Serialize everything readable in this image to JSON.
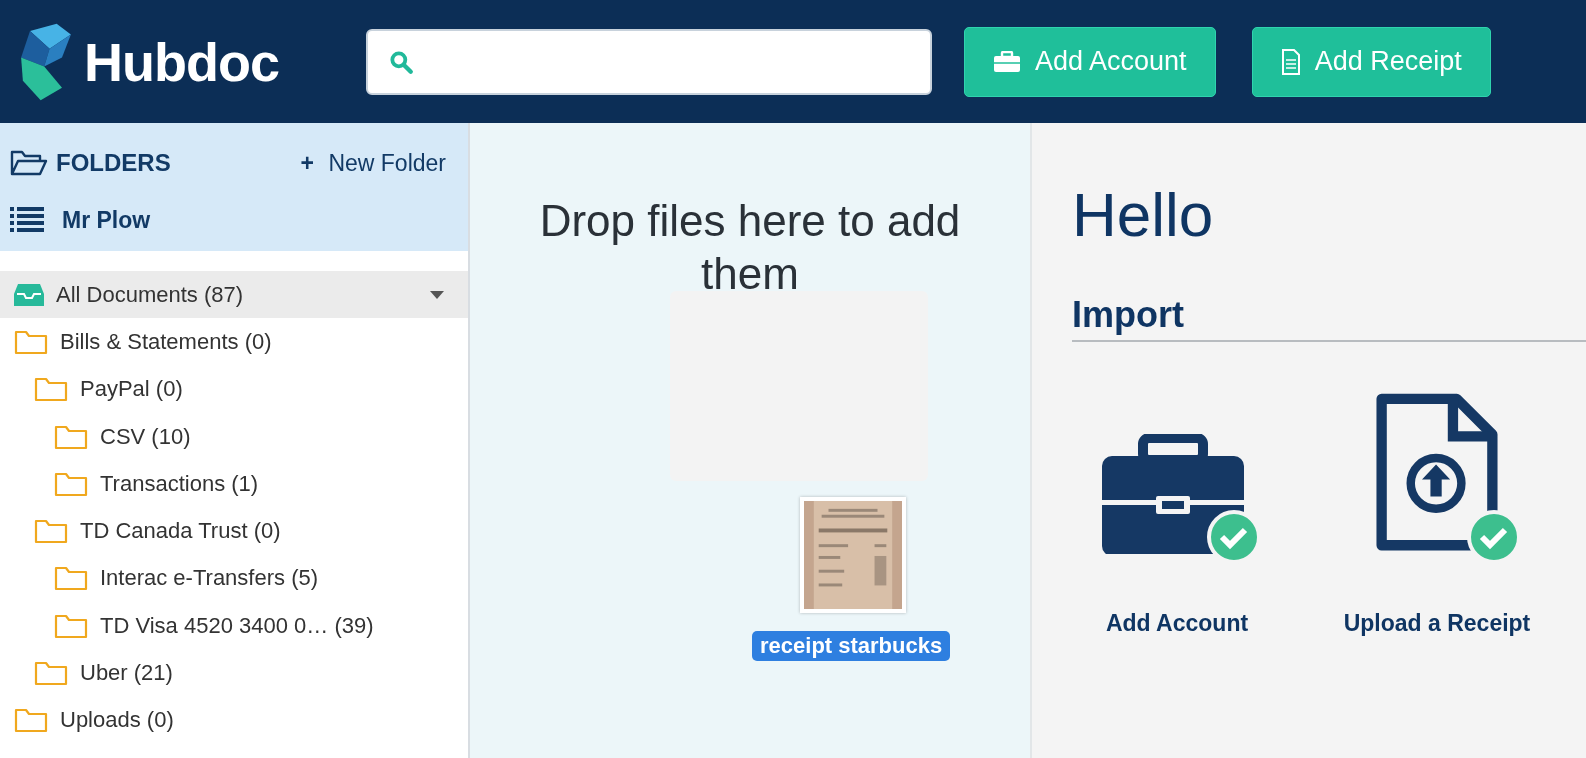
{
  "header": {
    "logo": "Hubdoc",
    "buttons": [
      {
        "label": "Add Account",
        "kind": "account"
      },
      {
        "label": "Add Receipt",
        "kind": "receipt"
      }
    ]
  },
  "sidebar": {
    "title": "FOLDERS",
    "new_folder": {
      "icon": "+",
      "label": "New Folder"
    },
    "user": "Mr Plow",
    "tree": [
      {
        "label": "All Documents (87)",
        "kind": "inbox",
        "selected": true,
        "expanded": true,
        "children": [
          {
            "label": "Bills & Statements (0)",
            "kind": "folder",
            "selected": false,
            "children": [
              {
                "label": "PayPal (0)",
                "kind": "folder",
                "selected": false,
                "children": [
                  {
                    "label": "CSV (10)",
                    "kind": "folder",
                    "selected": false
                  },
                  {
                    "label": "Transactions (1)",
                    "kind": "folder",
                    "selected": false
                  }
                ]
              },
              {
                "label": "TD Canada Trust (0)",
                "kind": "folder",
                "selected": false,
                "children": [
                  {
                    "label": "Interac e-Transfers (5)",
                    "kind": "folder",
                    "selected": false
                  },
                  {
                    "label": "TD Visa 4520 3400 0… (39)",
                    "kind": "folder",
                    "selected": false
                  }
                ]
              },
              {
                "label": "Uber (21)",
                "kind": "folder",
                "selected": false
              }
            ]
          },
          {
            "label": "Uploads (0)",
            "kind": "folder",
            "selected": false
          }
        ]
      }
    ]
  },
  "dropzone": {
    "message": "Drop files here to add them",
    "dragged_file": {
      "name": "receipt starbucks"
    }
  },
  "welcome": {
    "greeting": "Hello",
    "section": "Import",
    "options": [
      {
        "label": "Add Account",
        "kind": "account",
        "done": true
      },
      {
        "label": "Upload a Receipt",
        "kind": "receipt",
        "done": true
      }
    ]
  }
}
